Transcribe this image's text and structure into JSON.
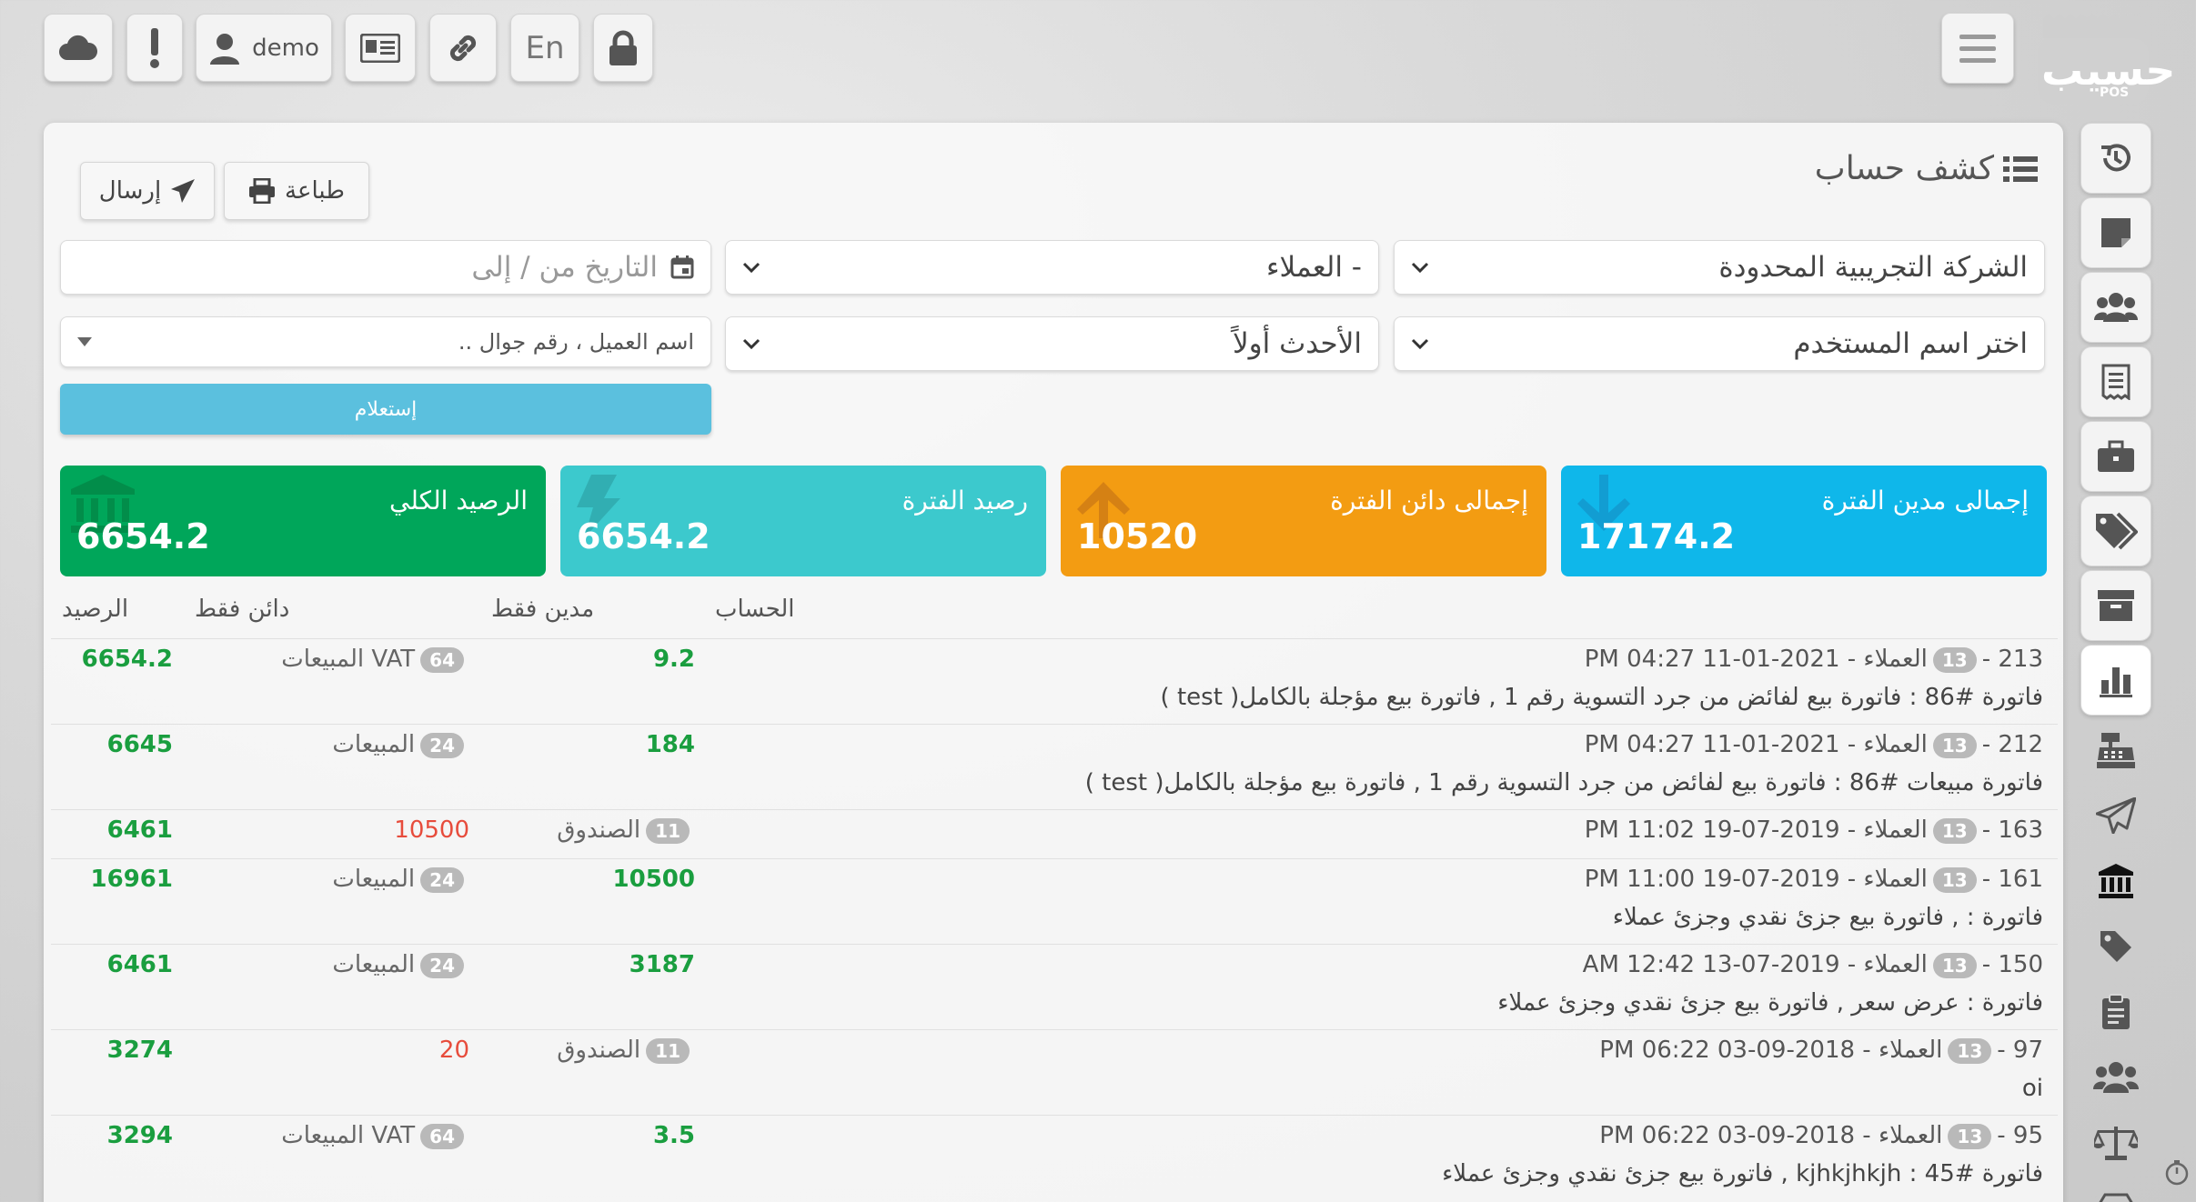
{
  "topbar": {
    "user_label": "demo",
    "lang_label": "En"
  },
  "logo": {
    "text": "حسيب",
    "sub": "POS"
  },
  "page": {
    "title": "كشف حساب",
    "print_label": "طباعة",
    "send_label": "إرسال"
  },
  "filters": {
    "company": "الشركة التجريبية المحدودة",
    "account_type": "- العملاء",
    "date_placeholder": "التاريخ من / إلى",
    "user_select": "اختر اسم المستخدم",
    "sort": "الأحدث أولاً",
    "customer_placeholder": "اسم العميل ، رقم جوال ..",
    "query_label": "إستعلام"
  },
  "cards": [
    {
      "label": "إجمالى مدين الفترة",
      "value": "17174.2",
      "color": "#0fb7ea"
    },
    {
      "label": "إجمالى دائن الفترة",
      "value": "10520",
      "color": "#f39c12"
    },
    {
      "label": "رصيد الفترة",
      "value": "6654.2",
      "color": "#3cc9cd"
    },
    {
      "label": "الرصيد الكلي",
      "value": "6654.2",
      "color": "#00a65a"
    }
  ],
  "table": {
    "headers": {
      "account": "الحساب",
      "debit": "مدين فقط",
      "credit": "دائن فقط",
      "balance": "الرصيد"
    },
    "rows": [
      {
        "id": "213 -",
        "badge": "13",
        "meta": "العملاء - 2021-01-11 04:27 PM",
        "desc": "فاتورة #86 : فاتورة بيع لفائض من جرد التسوية رقم 1 , فاتورة بيع مؤجلة بالكامل( test )",
        "counter_badge": "64",
        "counter": "VAT المبيعات",
        "debit": "9.2",
        "credit": "",
        "balance": "6654.2"
      },
      {
        "id": "212 -",
        "badge": "13",
        "meta": "العملاء - 2021-01-11 04:27 PM",
        "desc": "فاتورة مبيعات #86 : فاتورة بيع لفائض من جرد التسوية رقم 1 , فاتورة بيع مؤجلة بالكامل( test )",
        "counter_badge": "24",
        "counter": "المبيعات",
        "debit": "184",
        "credit": "",
        "balance": "6645"
      },
      {
        "id": "163 -",
        "badge": "13",
        "meta": "العملاء - 2019-07-19 11:02 PM",
        "desc": "",
        "counter_badge": "11",
        "counter": "الصندوق",
        "debit": "",
        "credit": "10500",
        "balance": "6461"
      },
      {
        "id": "161 -",
        "badge": "13",
        "meta": "العملاء - 2019-07-19 11:00 PM",
        "desc": "فاتورة : , فاتورة بيع جزئ نقدي وجزئ عملاء",
        "counter_badge": "24",
        "counter": "المبيعات",
        "debit": "10500",
        "credit": "",
        "balance": "16961"
      },
      {
        "id": "150 -",
        "badge": "13",
        "meta": "العملاء - 2019-07-13 12:42 AM",
        "desc": "فاتورة : عرض سعر , فاتورة بيع جزئ نقدي وجزئ عملاء",
        "counter_badge": "24",
        "counter": "المبيعات",
        "debit": "3187",
        "credit": "",
        "balance": "6461"
      },
      {
        "id": "97 -",
        "badge": "13",
        "meta": "العملاء - 2018-09-03 06:22 PM",
        "desc": "oi",
        "counter_badge": "11",
        "counter": "الصندوق",
        "debit": "",
        "credit": "20",
        "balance": "3274"
      },
      {
        "id": "95 -",
        "badge": "13",
        "meta": "العملاء - 2018-09-03 06:22 PM",
        "desc": "فاتورة #45 : kjhkjhkjh , فاتورة بيع جزئ نقدي وجزئ عملاء",
        "counter_badge": "64",
        "counter": "VAT المبيعات",
        "debit": "3.5",
        "credit": "",
        "balance": "3294"
      }
    ]
  },
  "sidebar_icons": [
    "history-icon",
    "note-icon",
    "users-icon",
    "receipt-icon",
    "briefcase-icon",
    "tags-icon",
    "box-icon",
    "chart-icon",
    "cash-register-icon",
    "send-icon",
    "bank-icon",
    "tag-icon",
    "clipboard-icon",
    "group-icon",
    "scale-icon",
    "boxes-icon"
  ]
}
